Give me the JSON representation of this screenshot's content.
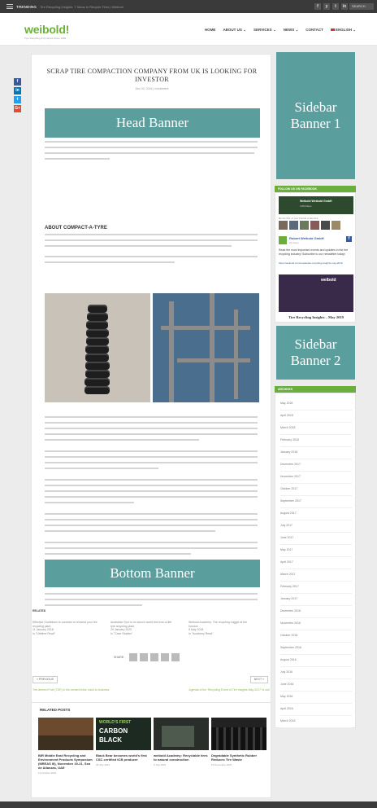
{
  "topbar": {
    "trending_label": "TRENDING",
    "ticker": "Tire Recycling Insights: 7 Ideas to Recycle Tires | Weibold",
    "socials": [
      "f",
      "y",
      "t",
      "in"
    ],
    "search_label": "SEARCH"
  },
  "header": {
    "logo": "weibold!",
    "tagline": "Tyre Recycling & Pyrolysis Since 1999",
    "nav": [
      "HOME",
      "ABOUT US",
      "SERVICES",
      "NEWS",
      "CONTACT",
      "ENGLISH"
    ],
    "nav_dropdown_marker": "⌄"
  },
  "share_buttons": [
    "f",
    "in",
    "t",
    "G+"
  ],
  "article": {
    "title": "SCRAP TIRE COMPACTION COMPANY FROM UK IS LOOKING FOR INVESTOR",
    "meta": "Dec 30, 2016 | Investment",
    "subheading": "ABOUT COMPACT-A-TYRE"
  },
  "banners": {
    "head": "Head Banner",
    "sidebar1": "Sidebar Banner 1",
    "sidebar2": "Sidebar Banner 2",
    "bottom": "Bottom Banner"
  },
  "related_inline": {
    "label": "RELATED",
    "items": [
      {
        "title": "Effective Guidelines to consider to reinvest your tire recycling plant",
        "date": "11 January 2018",
        "cat": "In \"Lifetime Read\""
      },
      {
        "title": "Australian Tyre to re-launch world first end-of-life tyre recycling plant",
        "date": "29 January 2020",
        "cat": "In \"Case Studies\""
      },
      {
        "title": "Weibold Academy: The recycling nugget at tire furnace",
        "date": "5 May 2018",
        "cat": "In \"Academy Read\""
      }
    ]
  },
  "share_label": "SHARE:",
  "pagination": {
    "prev": "« PREVIOUS",
    "next": "NEXT »",
    "prev_title": "Tire-derived Fuel (TDF) in the cement kilns: back to business",
    "next_title": "Agenda of the 'Recycling Event of Tire Insights May 2017' is out!"
  },
  "related_posts": {
    "heading": "RELATED POSTS",
    "items": [
      {
        "caption": "BIR Middle East Recycling and Environment Products Symposium (MREAS III), November 20-21, Sea de Alianzas, UAE",
        "date": "11 October 2016"
      },
      {
        "caption": "Black Bear becomes world's first CSC certified tCB producer",
        "date": "26 July 2021"
      },
      {
        "caption": "weibold Academy: Recyclable tires to natural construction",
        "date": "5 July 2021"
      },
      {
        "caption": "Degradable Synthetic Rubber Reduces Tire Waste",
        "date": "15 November 2021"
      }
    ],
    "thumb2_text": [
      "WORLD'S FIRST",
      "CARBON",
      "BLACK"
    ]
  },
  "sidebar": {
    "follow_header": "FOLLOW US ON FACEBOOK",
    "fb_page": "Weibold Weibold GmbH",
    "fb_likes": "4,563 likes",
    "fb_friends": "Be the first of your friends to like this",
    "fb_post_name": "Robert Weibold GmbH",
    "fb_post_time": "21 hours",
    "fb_post_text": "Read the most important events and updates in the tire recycling industry! Subscribe to our newsletter today!",
    "fb_post_link": "https://weibold.com/newsletter-recycling-insights-may-2019",
    "weibold_brand": "weibold",
    "insights_caption": "Tire Recycling Insights – May 2019",
    "archives_header": "ARCHIVES",
    "archives": [
      "May 2018",
      "April 2018",
      "March 2018",
      "February 2018",
      "January 2018",
      "December 2017",
      "November 2017",
      "October 2017",
      "September 2017",
      "August 2017",
      "July 2017",
      "June 2017",
      "May 2017",
      "April 2017",
      "March 2017",
      "February 2017",
      "January 2017",
      "December 2016",
      "November 2016",
      "October 2016",
      "September 2016",
      "August 2016",
      "July 2016",
      "June 2016",
      "May 2016",
      "April 2016",
      "March 2016"
    ]
  },
  "colors": {
    "brand_green": "#6bae3b",
    "banner_teal": "#5a9e9e",
    "dark_bar": "#3a3a3a",
    "facebook": "#3b5998",
    "linkedin": "#0077b5",
    "twitter": "#1da1f2",
    "google_plus": "#dd4b39"
  }
}
